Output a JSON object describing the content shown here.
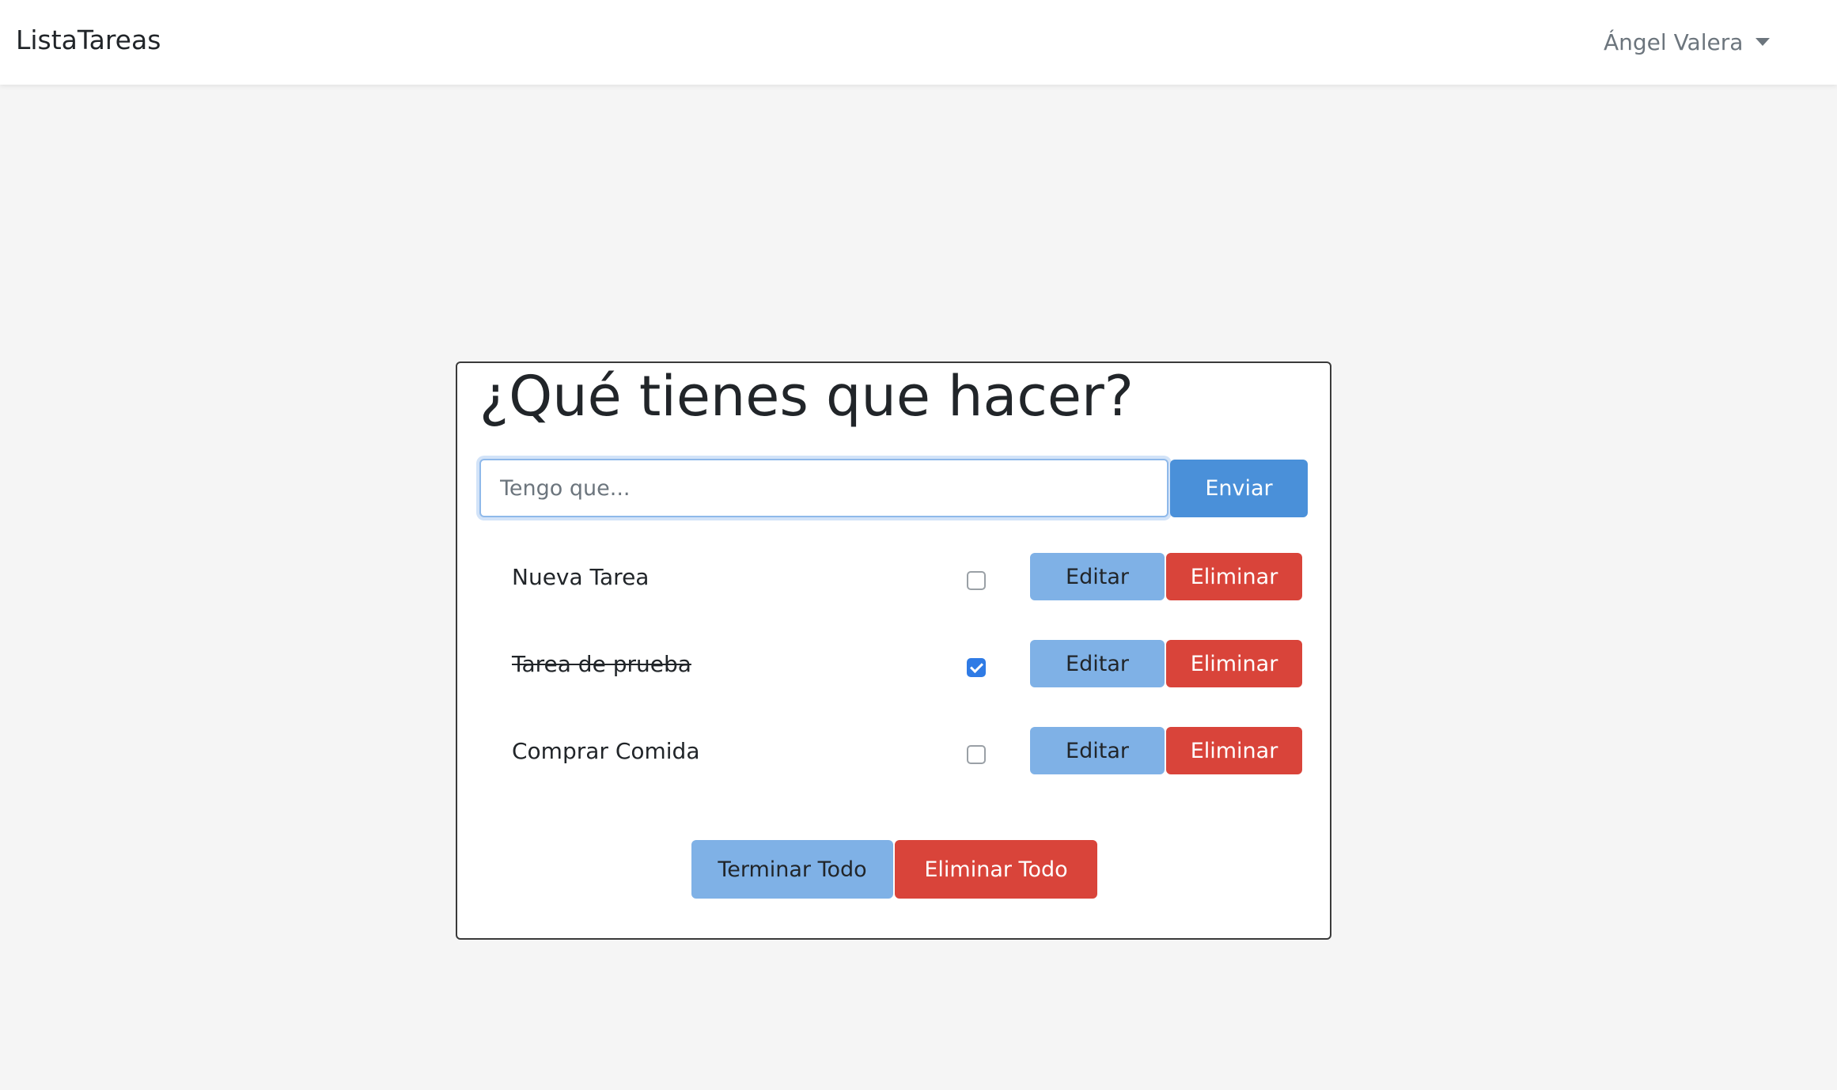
{
  "navbar": {
    "brand": "ListaTareas",
    "user_name": "Ángel Valera"
  },
  "main": {
    "title": "¿Qué tienes que hacer?",
    "input": {
      "placeholder": "Tengo que...",
      "value": ""
    },
    "send_label": "Enviar",
    "tasks": [
      {
        "label": "Nueva Tarea",
        "done": false,
        "edit_label": "Editar",
        "delete_label": "Eliminar"
      },
      {
        "label": "Tarea de prueba",
        "done": true,
        "edit_label": "Editar",
        "delete_label": "Eliminar"
      },
      {
        "label": "Comprar Comida",
        "done": false,
        "edit_label": "Editar",
        "delete_label": "Eliminar"
      }
    ],
    "finish_all_label": "Terminar Todo",
    "delete_all_label": "Eliminar Todo"
  },
  "colors": {
    "primary": "#4a90d9",
    "light_primary": "#7fb1e6",
    "danger": "#d9443a",
    "checkbox_checked": "#2f7be5",
    "background": "#f5f5f5"
  },
  "icons": {
    "user_menu_caret": "caret-down-icon"
  }
}
